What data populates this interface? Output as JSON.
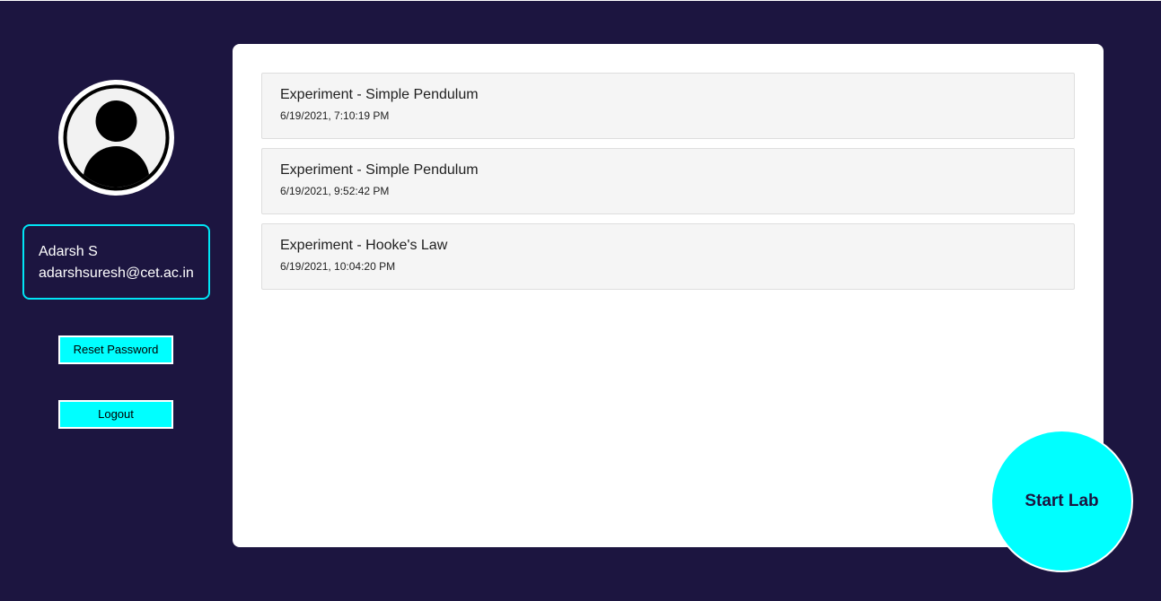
{
  "sidebar": {
    "avatar_icon": "user-icon",
    "user": {
      "name": "Adarsh S",
      "email": "adarshsuresh@cet.ac.in"
    },
    "reset_password_label": "Reset Password",
    "logout_label": "Logout"
  },
  "main": {
    "experiments": [
      {
        "title": "Experiment - Simple Pendulum",
        "timestamp": "6/19/2021, 7:10:19 PM"
      },
      {
        "title": "Experiment - Simple Pendulum",
        "timestamp": "6/19/2021, 9:52:42 PM"
      },
      {
        "title": "Experiment - Hooke's Law",
        "timestamp": "6/19/2021, 10:04:20 PM"
      }
    ]
  },
  "start_lab_label": "Start Lab",
  "colors": {
    "background": "#1c1540",
    "accent": "#00ffff",
    "card_border": "#00e5f5",
    "panel": "#ffffff",
    "list_item_bg": "#f5f5f5"
  }
}
